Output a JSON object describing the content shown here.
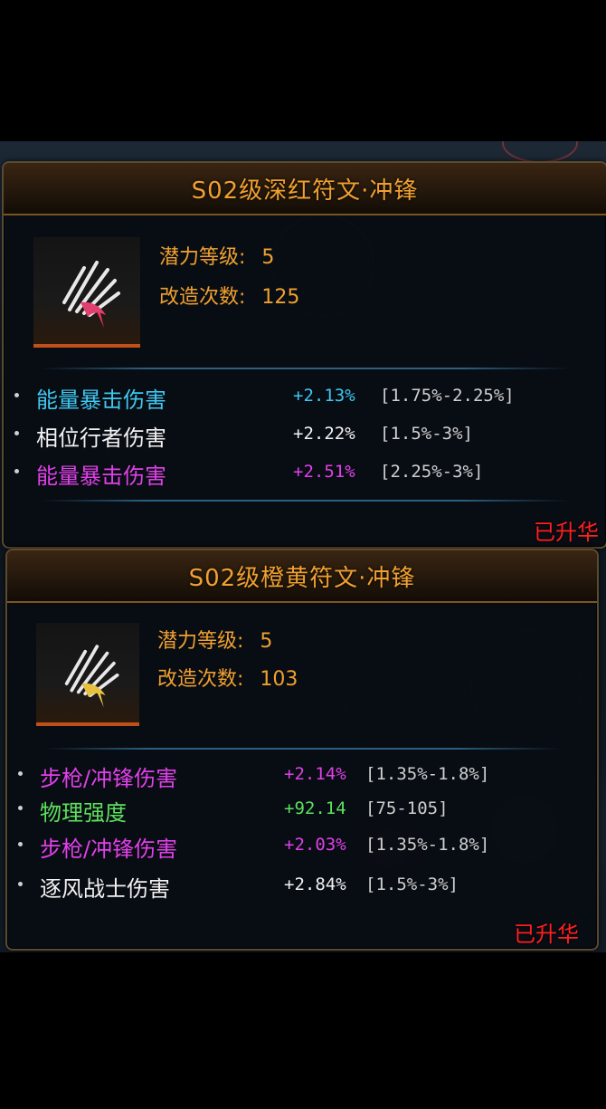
{
  "colors": {
    "title": "#f0a030",
    "cyan": "#3fc7f0",
    "white": "#f2f2f2",
    "magenta": "#e040e8",
    "green": "#5ee05e",
    "range": "#cfcfcf",
    "upgraded": "#ff2020"
  },
  "cards": [
    {
      "title": "S02级深红符文·冲锋",
      "potential_label": "潜力等级:",
      "potential_value": "5",
      "reforge_label": "改造次数:",
      "reforge_value": "125",
      "icon": "claw-rune-red-icon",
      "stats": [
        {
          "name": "能量暴击伤害",
          "value": "+2.13%",
          "range": "[1.75%-2.25%]",
          "color": "cyan"
        },
        {
          "name": "相位行者伤害",
          "value": "+2.22%",
          "range": "[1.5%-3%]",
          "color": "white"
        },
        {
          "name": "能量暴击伤害",
          "value": "+2.51%",
          "range": "[2.25%-3%]",
          "color": "magenta"
        }
      ],
      "status": "已升华"
    },
    {
      "title": "S02级橙黄符文·冲锋",
      "potential_label": "潜力等级:",
      "potential_value": "5",
      "reforge_label": "改造次数:",
      "reforge_value": "103",
      "icon": "claw-rune-yellow-icon",
      "stats": [
        {
          "name": "步枪/冲锋伤害",
          "value": "+2.14%",
          "range": "[1.35%-1.8%]",
          "color": "magenta"
        },
        {
          "name": "物理强度",
          "value": "+92.14",
          "range": "[75-105]",
          "color": "green"
        },
        {
          "name": "步枪/冲锋伤害",
          "value": "+2.03%",
          "range": "[1.35%-1.8%]",
          "color": "magenta"
        },
        {
          "name": "逐风战士伤害",
          "value": "+2.84%",
          "range": "[1.5%-3%]",
          "color": "white"
        }
      ],
      "status": "已升华"
    }
  ]
}
